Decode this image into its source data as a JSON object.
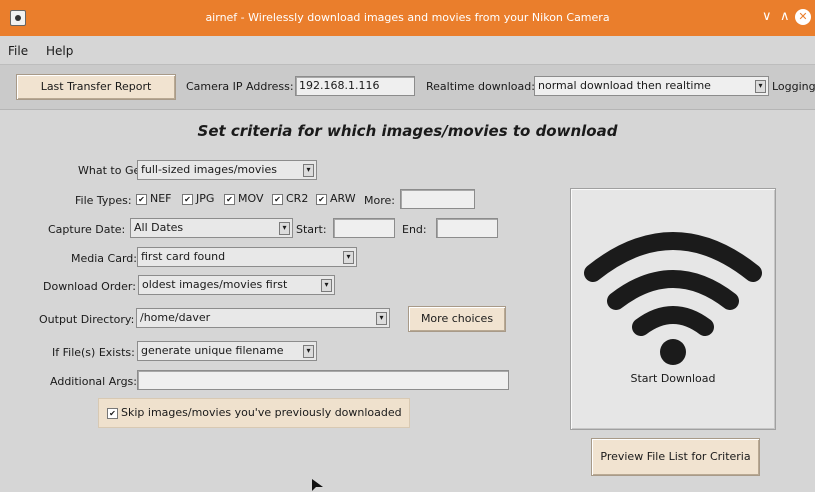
{
  "window": {
    "title": "airnef - Wirelessly download images and movies from your Nikon Camera",
    "minimize": "∨",
    "maximize": "∧",
    "close": "✕"
  },
  "menu": {
    "file": "File",
    "help": "Help"
  },
  "toolbar": {
    "last_transfer_report": "Last Transfer Report",
    "camera_ip_label": "Camera IP Address:",
    "camera_ip_value": "192.168.1.116",
    "realtime_label": "Realtime download:",
    "realtime_value": "normal download then realtime",
    "logging_label": "Logging"
  },
  "heading": "Set criteria for which images/movies to download",
  "form": {
    "what_to_get": {
      "label": "What to Get:",
      "value": "full-sized images/movies"
    },
    "file_types": {
      "label": "File Types:",
      "options": [
        {
          "label": "NEF",
          "checked": true
        },
        {
          "label": "JPG",
          "checked": true
        },
        {
          "label": "MOV",
          "checked": true
        },
        {
          "label": "CR2",
          "checked": true
        },
        {
          "label": "ARW",
          "checked": true
        }
      ],
      "more_label": "More:",
      "more_value": ""
    },
    "capture_date": {
      "label": "Capture Date:",
      "value": "All Dates",
      "start_label": "Start:",
      "start_value": "",
      "end_label": "End:",
      "end_value": ""
    },
    "media_card": {
      "label": "Media Card:",
      "value": "first card found"
    },
    "download_order": {
      "label": "Download Order:",
      "value": "oldest images/movies first"
    },
    "output_directory": {
      "label": "Output Directory:",
      "value": "/home/daver",
      "more_choices": "More choices"
    },
    "if_file_exists": {
      "label": "If File(s) Exists:",
      "value": "generate unique filename"
    },
    "additional_args": {
      "label": "Additional Args:",
      "value": ""
    },
    "skip_previous": {
      "label": "Skip images/movies you've previously downloaded",
      "checked": true
    }
  },
  "start_download": {
    "label": "Start Download",
    "icon": "wifi-icon"
  },
  "preview_button": "Preview File List for Criteria",
  "colors": {
    "titlebar": "#ea7e2c",
    "button": "#f1e3d0",
    "background": "#d6d6d6"
  }
}
